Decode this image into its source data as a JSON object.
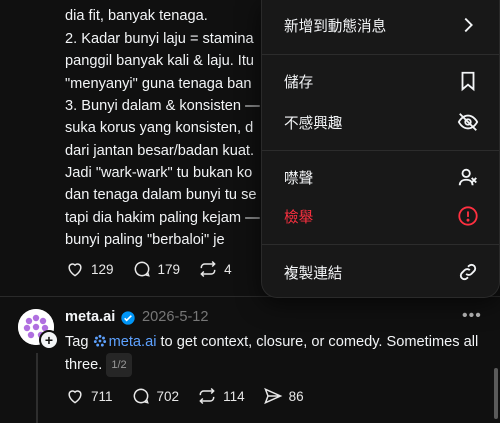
{
  "post1": {
    "lines": [
      "dia fit, banyak tenaga.",
      "2. Kadar bunyi laju = stamina",
      "panggil banyak kali & laju. Itu",
      "\"menyanyi\" guna tenaga ban",
      "3. Bunyi dalam & konsisten —",
      "suka korus yang konsisten, d",
      "dari jantan besar/badan kuat.",
      "Jadi \"wark-wark\" tu bukan ko",
      "dan tenaga dalam bunyi tu se",
      "tapi dia hakim paling kejam —",
      "bunyi paling \"berbaloi\" je"
    ],
    "likes": "129",
    "replies": "179",
    "reposts": "4"
  },
  "menu": {
    "add_feed": "新增到動態消息",
    "save": "儲存",
    "not_interested": "不感興趣",
    "mute": "噤聲",
    "report": "檢舉",
    "copy_link": "複製連結",
    "colors": {
      "danger": "#ff3040"
    }
  },
  "post2": {
    "username": "meta.ai",
    "date": "2026-5-12",
    "text_before": "Tag ",
    "tag": "meta.ai",
    "text_after": " to get context, closure, or comedy. Sometimes all three.",
    "pager": "1/2",
    "likes": "711",
    "replies": "702",
    "reposts": "114",
    "shares": "86",
    "accent": "#5ea2ff"
  }
}
